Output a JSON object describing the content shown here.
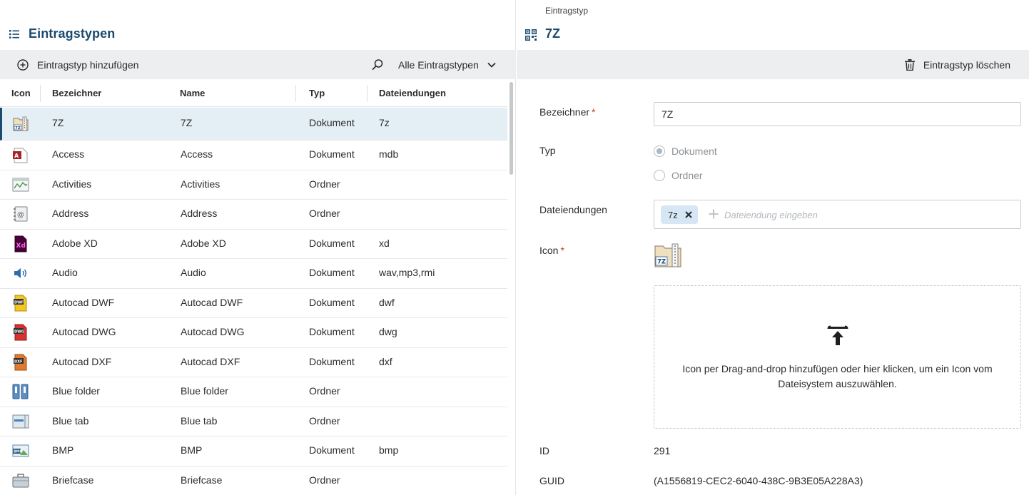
{
  "left": {
    "title": "Eintragstypen",
    "toolbar": {
      "add_label": "Eintragstyp hinzufügen",
      "filter_label": "Alle Eintragstypen"
    },
    "columns": {
      "icon": "Icon",
      "identifier": "Bezeichner",
      "name": "Name",
      "type": "Typ",
      "extensions": "Dateiendungen"
    },
    "rows": [
      {
        "icon": "archive-7z-icon",
        "identifier": "7Z",
        "name": "7Z",
        "type": "Dokument",
        "extensions": "7z",
        "selected": true
      },
      {
        "icon": "access-icon",
        "identifier": "Access",
        "name": "Access",
        "type": "Dokument",
        "extensions": "mdb"
      },
      {
        "icon": "activities-icon",
        "identifier": "Activities",
        "name": "Activities",
        "type": "Ordner",
        "extensions": ""
      },
      {
        "icon": "address-icon",
        "identifier": "Address",
        "name": "Address",
        "type": "Ordner",
        "extensions": ""
      },
      {
        "icon": "adobe-xd-icon",
        "identifier": "Adobe XD",
        "name": "Adobe XD",
        "type": "Dokument",
        "extensions": "xd"
      },
      {
        "icon": "audio-icon",
        "identifier": "Audio",
        "name": "Audio",
        "type": "Dokument",
        "extensions": "wav,mp3,rmi"
      },
      {
        "icon": "autocad-dwf-icon",
        "identifier": "Autocad DWF",
        "name": "Autocad DWF",
        "type": "Dokument",
        "extensions": "dwf"
      },
      {
        "icon": "autocad-dwg-icon",
        "identifier": "Autocad DWG",
        "name": "Autocad DWG",
        "type": "Dokument",
        "extensions": "dwg"
      },
      {
        "icon": "autocad-dxf-icon",
        "identifier": "Autocad DXF",
        "name": "Autocad DXF",
        "type": "Dokument",
        "extensions": "dxf"
      },
      {
        "icon": "blue-folder-icon",
        "identifier": "Blue folder",
        "name": "Blue folder",
        "type": "Ordner",
        "extensions": ""
      },
      {
        "icon": "blue-tab-icon",
        "identifier": "Blue tab",
        "name": "Blue tab",
        "type": "Ordner",
        "extensions": ""
      },
      {
        "icon": "bmp-icon",
        "identifier": "BMP",
        "name": "BMP",
        "type": "Dokument",
        "extensions": "bmp"
      },
      {
        "icon": "briefcase-icon",
        "identifier": "Briefcase",
        "name": "Briefcase",
        "type": "Ordner",
        "extensions": ""
      }
    ]
  },
  "right": {
    "overline": "Eintragstyp",
    "title": "7Z",
    "toolbar": {
      "delete_label": "Eintragstyp löschen"
    },
    "form": {
      "identifier_label": "Bezeichner",
      "identifier_value": "7Z",
      "required_mark": "*",
      "type_label": "Typ",
      "type_options": [
        "Dokument",
        "Ordner"
      ],
      "extensions_label": "Dateiendungen",
      "extension_chip": "7z",
      "extension_placeholder": "Dateiendung eingeben",
      "icon_label": "Icon",
      "dropzone_text": "Icon per Drag-and-drop hinzufügen oder hier klicken, um ein Icon vom Dateisystem auszuwählen.",
      "id_label": "ID",
      "id_value": "291",
      "guid_label": "GUID",
      "guid_value": "(A1556819-CEC2-6040-438C-9B3E05A228A3)"
    }
  },
  "colors": {
    "accent": "#1b4a70",
    "toolbar_bg": "#eceeef",
    "selected_row": "#e4eef5",
    "chip_bg": "#d6e6f4",
    "required": "#c0392b"
  }
}
